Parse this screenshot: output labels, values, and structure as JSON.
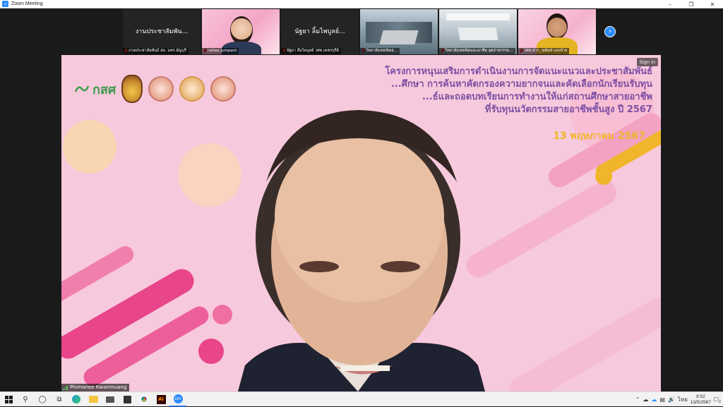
{
  "window": {
    "title": "Zoom Meeting",
    "app_icon": "zoom-icon",
    "controls": [
      "minimize-icon",
      "restore-icon",
      "close-icon"
    ]
  },
  "gallery": {
    "tiles": [
      {
        "center_name": "งานประชาสัมพัน...",
        "label": "งานประชาสัมพันธ์ สอ. มทร.อัญบุรี",
        "mic_muted": true,
        "style": "name-only"
      },
      {
        "center_name": "",
        "label": "ratree Jumpant",
        "mic_muted": true,
        "style": "video-woman"
      },
      {
        "center_name": "นัฐยา ลิ้มไพบูลย์...",
        "label": "นัฐยา ลิ้มไพบูลย์ วศท.เพชรบุรีย์",
        "mic_muted": true,
        "style": "name-only"
      },
      {
        "center_name": "",
        "label": "วิทยาลัยเทคนิคสุ...",
        "mic_muted": true,
        "style": "video-room"
      },
      {
        "center_name": "",
        "label": "วิทยาลัยเทคนิคและอาชีพ อุตสาหกรรม...",
        "mic_muted": true,
        "style": "video-room2"
      },
      {
        "center_name": "",
        "label": "วศท.สาก_ณพิมพ์ แสงจ้าย",
        "mic_muted": true,
        "style": "video-man"
      }
    ],
    "next_icon": "chevron-right-icon"
  },
  "speaker": {
    "name": "Pinmanee Kwanmuang",
    "sign_in_label": "Sign in",
    "slide": {
      "logo_text": "กสศ",
      "title_lines": [
        "โครงการหนุนเสริมการดำเนินงานการจัดแนะแนวและประชาสัมพันธ์",
        "...ศึกษา การค้นหาคัดกรองความยากจนและคัดเลือกนักเรียนรับทุน",
        "...ธ์และถอดบทเรียนการทำงานให้แก่สถานศึกษาสายอาชีพ",
        "ที่รับทุนนวัตกรรมสายอาชีพชั้นสูง ปี 2567"
      ],
      "date": "13 พฤษภาคม 2567",
      "colors": {
        "accent_pink": "#e8458b",
        "accent_yellow": "#f0b52a",
        "title_purple": "#7c4fa3",
        "logo_green": "#3e9b4c"
      }
    }
  },
  "taskbar": {
    "items": [
      "windows-start-icon",
      "search-icon",
      "cortana-icon",
      "task-view-icon",
      "edge-icon",
      "file-explorer-icon",
      "mail-icon",
      "store-icon",
      "chrome-icon",
      "illustrator-icon",
      "zoom-icon"
    ],
    "active": "zoom-icon",
    "illustrator_label": "Ai",
    "zoom_label": "zm",
    "tray": {
      "icons": [
        "chevron-up-icon",
        "onedrive-icon",
        "cloud-icon",
        "network-icon",
        "volume-icon",
        "language-icon"
      ],
      "language": "ไทย",
      "time": "9:52",
      "date": "13/5/2567",
      "notifications_count": "2"
    }
  }
}
